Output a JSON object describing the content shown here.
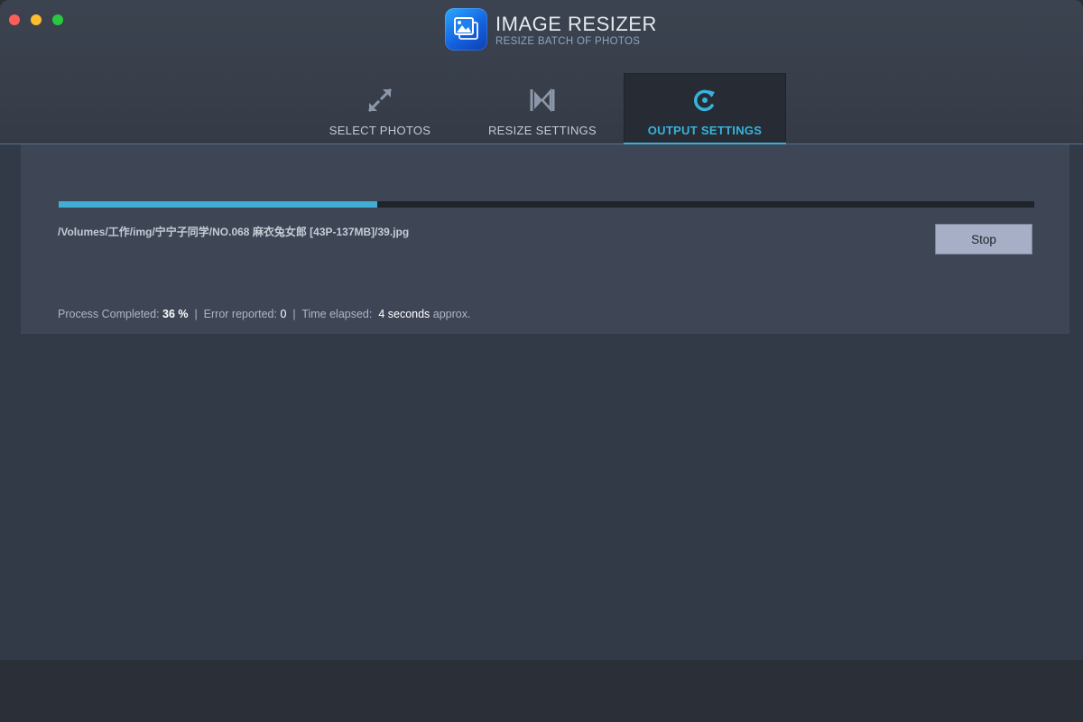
{
  "app": {
    "title": "IMAGE RESIZER",
    "subtitle": "RESIZE BATCH OF PHOTOS",
    "icon": "app-photos-icon"
  },
  "tabs": [
    {
      "label": "SELECT PHOTOS",
      "icon": "expand-arrows-icon",
      "active": false
    },
    {
      "label": "RESIZE SETTINGS",
      "icon": "resize-bowtie-icon",
      "active": false
    },
    {
      "label": "OUTPUT SETTINGS",
      "icon": "refresh-cycle-icon",
      "active": true
    }
  ],
  "progress": {
    "fraction": 0.327,
    "current_file": "/Volumes/工作/img/宁宁子同学/NO.068 麻衣兔女郎 [43P-137MB]/39.jpg",
    "stop_label": "Stop"
  },
  "status": {
    "completed_label": "Process Completed: ",
    "completed_value": "36 %",
    "sep1": "  |  ",
    "error_label": "Error reported: ",
    "error_value": "0",
    "sep2": "  |  ",
    "elapsed_label": "Time elapsed:  ",
    "elapsed_value": "4 seconds",
    "elapsed_suffix": " approx."
  },
  "colors": {
    "accent": "#42aed3",
    "active_tab_label": "#38b3dd",
    "panel": "#3e4656",
    "background": "#333a47"
  }
}
